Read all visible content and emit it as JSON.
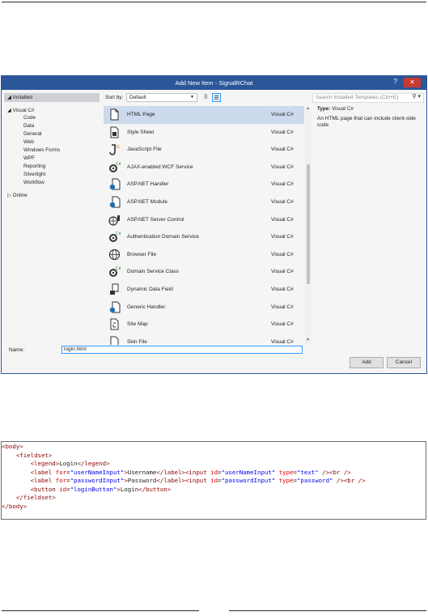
{
  "dialog": {
    "title": "Add New Item - SignalRChat",
    "help": "?",
    "close": "✕"
  },
  "left_panel": {
    "installed": "Installed",
    "visual_csharp": "Visual C#",
    "children": [
      "Code",
      "Data",
      "General",
      "Web",
      "Windows Forms",
      "WPF",
      "Reporting",
      "Silverlight",
      "Workflow"
    ],
    "selected_child": "Web",
    "online": "Online"
  },
  "toolbar": {
    "sort_label": "Sort by:",
    "sort_value": "Default"
  },
  "search": {
    "placeholder": "Search Installed Templates (Ctrl+E)"
  },
  "templates": [
    {
      "name": "HTML Page",
      "lang": "Visual C#",
      "icon": "html-page-icon"
    },
    {
      "name": "Style Sheet",
      "lang": "Visual C#",
      "icon": "style-sheet-icon"
    },
    {
      "name": "JavaScript File",
      "lang": "Visual C#",
      "icon": "javascript-file-icon"
    },
    {
      "name": "AJAX-enabled WCF Service",
      "lang": "Visual C#",
      "icon": "wcf-service-icon"
    },
    {
      "name": "ASP.NET Handler",
      "lang": "Visual C#",
      "icon": "aspnet-handler-icon"
    },
    {
      "name": "ASP.NET Module",
      "lang": "Visual C#",
      "icon": "aspnet-module-icon"
    },
    {
      "name": "ASP.NET Server Control",
      "lang": "Visual C#",
      "icon": "server-control-icon"
    },
    {
      "name": "Authentication Domain Service",
      "lang": "Visual C#",
      "icon": "domain-service-icon"
    },
    {
      "name": "Browser File",
      "lang": "Visual C#",
      "icon": "browser-file-icon"
    },
    {
      "name": "Domain Service Class",
      "lang": "Visual C#",
      "icon": "domain-service-class-icon"
    },
    {
      "name": "Dynamic Data Field",
      "lang": "Visual C#",
      "icon": "dynamic-data-field-icon"
    },
    {
      "name": "Generic Handler",
      "lang": "Visual C#",
      "icon": "generic-handler-icon"
    },
    {
      "name": "Site Map",
      "lang": "Visual C#",
      "icon": "site-map-icon"
    },
    {
      "name": "Skin File",
      "lang": "Visual C#",
      "icon": "skin-file-icon"
    }
  ],
  "details": {
    "type_label": "Type:",
    "type_value": "Visual C#",
    "description": "An HTML page that can include client-side code"
  },
  "bottom": {
    "name_label": "Name:",
    "name_value": "login.html",
    "add": "Add",
    "cancel": "Cancel"
  },
  "code": {
    "body_open": "body>",
    "fieldset_open": "fieldset",
    "legend_text": "Login",
    "username_for": "\"userNameInput\"",
    "username_text": "Username",
    "username_id": "\"userNameInput\"",
    "username_type": "\"text\"",
    "password_for": "\"passwordInput\"",
    "password_text": "Password",
    "password_id": "\"passwordInput\"",
    "password_type": "\"password\"",
    "button_id": "\"loginButton\"",
    "button_text": "Login",
    "fieldset_close": "fieldset",
    "body_close": "/body>"
  }
}
